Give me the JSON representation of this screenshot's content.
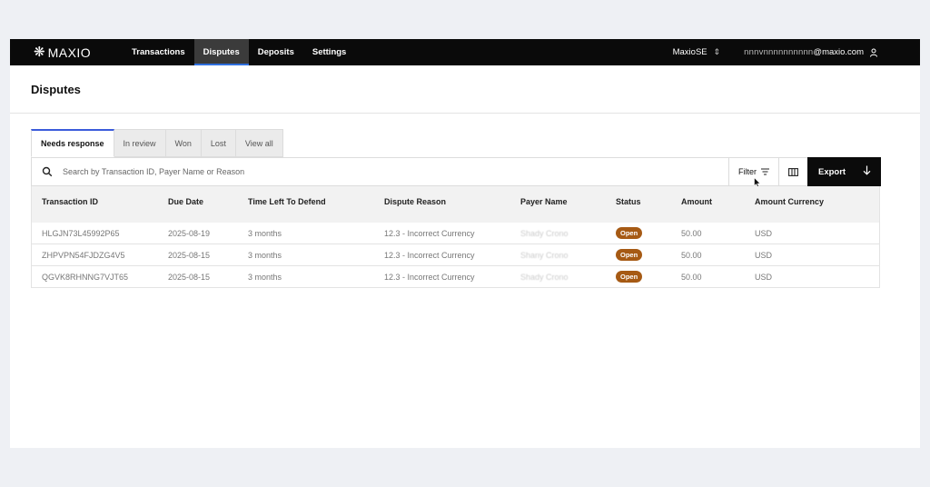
{
  "nav": {
    "logo": "MAXIO",
    "tabs": [
      "Transactions",
      "Disputes",
      "Deposits",
      "Settings"
    ],
    "active_tab": 1,
    "org": "MaxioSE",
    "user_email_redacted": "nnnvnnnnnnnnnn",
    "user_email_domain": "@maxio.com"
  },
  "page": {
    "title": "Disputes"
  },
  "tabs": [
    "Needs response",
    "In review",
    "Won",
    "Lost",
    "View all"
  ],
  "search": {
    "placeholder": "Search by Transaction ID, Payer Name or Reason"
  },
  "toolbar": {
    "filter_label": "Filter",
    "export_label": "Export"
  },
  "table": {
    "columns": [
      "Transaction ID",
      "Due Date",
      "Time Left To Defend",
      "Dispute Reason",
      "Payer Name",
      "Status",
      "Amount",
      "Amount Currency"
    ],
    "rows": [
      [
        "HLGJN73L45992P65",
        "2025-08-19",
        "3 months",
        "12.3 - Incorrect Currency",
        "Shady Crono",
        "Open",
        "50.00",
        "USD"
      ],
      [
        "ZHPVPN54FJDZG4V5",
        "2025-08-15",
        "3 months",
        "12.3 - Incorrect Currency",
        "Shany Crono",
        "Open",
        "50.00",
        "USD"
      ],
      [
        "QGVK8RHNNG7VJT65",
        "2025-08-15",
        "3 months",
        "12.3 - Incorrect Currency",
        "Shady Crono",
        "Open",
        "50.00",
        "USD"
      ]
    ]
  },
  "colors": {
    "nav_bg": "#0a0a0a",
    "accent": "#2f6fde",
    "status_open": "#a65a14",
    "export_bg": "#0b0b0b"
  },
  "icons": [
    "maxio-logo-icon",
    "chevron-updown-icon",
    "user-icon",
    "search-icon",
    "filter-icon",
    "columns-icon",
    "arrow-down-icon",
    "cursor-icon"
  ]
}
